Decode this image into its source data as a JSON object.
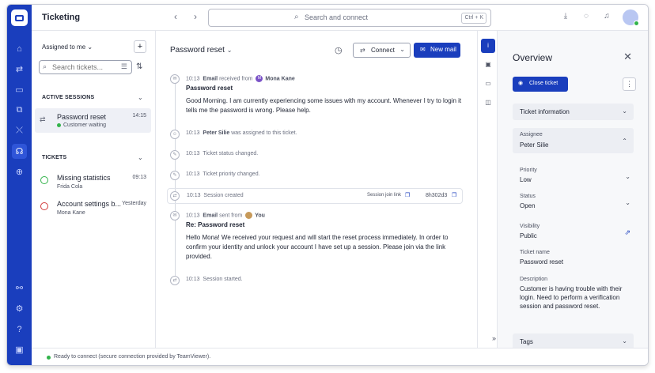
{
  "app": {
    "title": "Ticketing"
  },
  "search": {
    "placeholder": "Search and connect",
    "shortcut": "Ctrl + K"
  },
  "sessions_panel": {
    "filter_label": "Assigned to me",
    "search_placeholder": "Search tickets...",
    "active_sessions_title": "ACTIVE SESSIONS",
    "active_sessions": [
      {
        "name": "Password reset",
        "time": "14:15",
        "status": "Customer waiting"
      }
    ],
    "tickets_title": "TICKETS",
    "tickets": [
      {
        "name": "Missing statistics",
        "time": "09:13",
        "person": "Frida Cola",
        "color": "#32b34a"
      },
      {
        "name": "Account settings b...",
        "time": "Yesterday",
        "person": "Mona Kane",
        "color": "#d23a3a"
      }
    ]
  },
  "conversation": {
    "title": "Password reset",
    "connect_label": "Connect",
    "new_mail_label": "New mail",
    "events": [
      {
        "time": "10:13",
        "prefix": "Email",
        "text": "received from",
        "person": "Mona Kane",
        "avatar_initial": "M",
        "avatar_color": "#7a52c7",
        "subject": "Password reset",
        "body": "Good Morning. I am currently experiencing some issues with my account. Whenever I try to login it tells me the password is wrong. Please help."
      },
      {
        "time": "10:13",
        "person": "Peter Silie",
        "text": "was assigned to this ticket."
      },
      {
        "time": "10:13",
        "text": "Ticket status changed."
      },
      {
        "time": "10:13",
        "text": "Ticket priority changed."
      },
      {
        "time": "10:13",
        "text": "Session created",
        "link_label": "Session join link",
        "code": "8h302d3"
      },
      {
        "time": "10:13",
        "prefix": "Email",
        "text": "sent from",
        "person": "You",
        "subject": "Re: Password reset",
        "body": "Hello Mona! We received your request and will start the reset process immediately. In order to confirm your identity and unlock your account I have set up a session. Please join via the link provided."
      },
      {
        "time": "10:13",
        "text": "Session started."
      }
    ]
  },
  "overview": {
    "title": "Overview",
    "close_ticket_label": "Close ticket",
    "ticket_info_label": "Ticket information",
    "assignee": {
      "label": "Assignee",
      "value": "Peter Silie"
    },
    "priority": {
      "label": "Priority",
      "value": "Low"
    },
    "status": {
      "label": "Status",
      "value": "Open"
    },
    "visibility": {
      "label": "Visibility",
      "value": "Public"
    },
    "ticket_name": {
      "label": "Ticket name",
      "value": "Password reset"
    },
    "description": {
      "label": "Description",
      "value": "Customer is having trouble with their login. Need to perform a verification session and password reset."
    },
    "tags_label": "Tags"
  },
  "statusbar": {
    "text": "Ready to connect (secure connection provided by TeamViewer)."
  },
  "colors": {
    "brand": "#1a3ebd",
    "online": "#32b34a",
    "danger": "#d23a3a"
  },
  "icons": [
    "teamviewer-logo-icon",
    "home-icon",
    "transfer-icon",
    "devices-icon",
    "groups-icon",
    "flow-icon",
    "headset-icon",
    "add-circle-icon",
    "integrations-icon",
    "settings-icon",
    "help-icon",
    "feedback-icon"
  ]
}
